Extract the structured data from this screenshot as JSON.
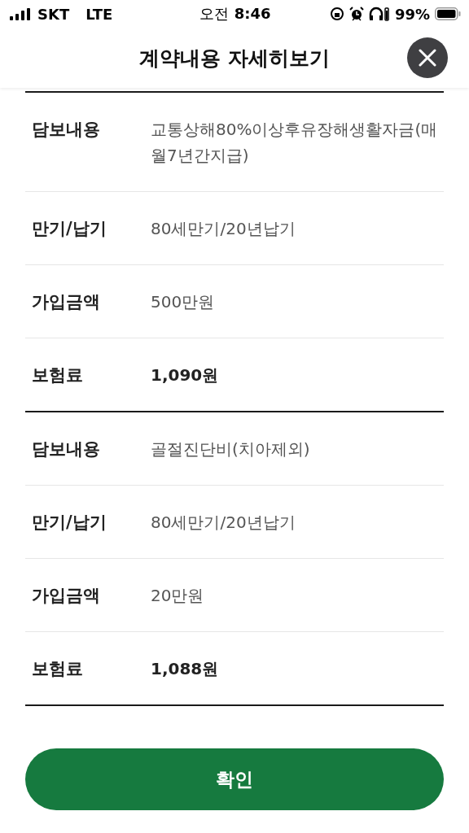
{
  "status_bar": {
    "carrier": "SKT",
    "network": "LTE",
    "time_prefix": "오전",
    "time": "8:46",
    "battery": "99%"
  },
  "header": {
    "title": "계약내용 자세히보기"
  },
  "groups": [
    {
      "rows": [
        {
          "label": "담보내용",
          "value": "교통상해80%이상후유장해생활자금(매월7년간지급)",
          "emphasis": false
        },
        {
          "label": "만기/납기",
          "value": "80세만기/20년납기",
          "emphasis": false
        },
        {
          "label": "가입금액",
          "value": "500만원",
          "emphasis": false
        },
        {
          "label": "보험료",
          "value": "1,090원",
          "emphasis": true
        }
      ]
    },
    {
      "rows": [
        {
          "label": "담보내용",
          "value": "골절진단비(치아제외)",
          "emphasis": false
        },
        {
          "label": "만기/납기",
          "value": "80세만기/20년납기",
          "emphasis": false
        },
        {
          "label": "가입금액",
          "value": "20만원",
          "emphasis": false
        },
        {
          "label": "보험료",
          "value": "1,088원",
          "emphasis": true
        }
      ]
    }
  ],
  "confirm_button": {
    "label": "확인"
  }
}
